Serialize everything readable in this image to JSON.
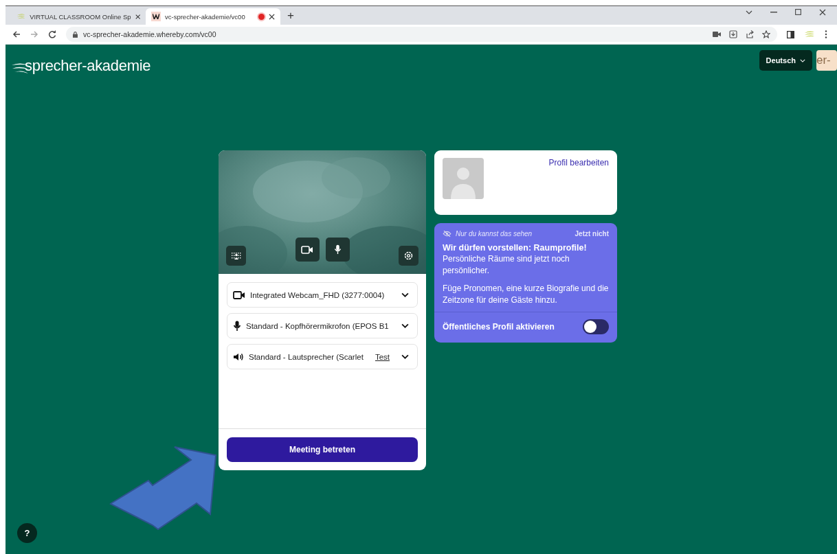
{
  "browser": {
    "tabs": [
      {
        "title": "VIRTUAL CLASSROOM Online Sp",
        "selected": false,
        "recording": false
      },
      {
        "title": "vc-sprecher-akademie/vc00",
        "selected": true,
        "recording": true
      }
    ],
    "new_tab": "+",
    "address": "vc-sprecher-akademie.whereby.com/vc00"
  },
  "header": {
    "logo": "sprecher-akademie",
    "language": "Deutsch",
    "brand_tile": "er-"
  },
  "preview": {
    "camera_on": true,
    "mic_on": true
  },
  "devices": [
    {
      "kind": "camera",
      "label": "Integrated Webcam_FHD (3277:0004)"
    },
    {
      "kind": "microphone",
      "label": "Standard - Kopfhörermikrofon (EPOS B1"
    },
    {
      "kind": "speaker",
      "label": "Standard - Lautsprecher (Scarlet",
      "test": "Test"
    }
  ],
  "join_button": "Meeting betreten",
  "profile": {
    "edit_link": "Profil bearbeiten"
  },
  "promo": {
    "notice": "Nur du kannst das sehen",
    "dismiss": "Jetzt nicht",
    "title": "Wir dürfen vorstellen: Raumprofile!",
    "lines": [
      "Persönliche Räume sind jetzt noch persönlicher.",
      "Füge Pronomen, eine kurze Biografie und die Zeitzone für deine Gäste hinzu."
    ],
    "toggle_label": "Öffentliches Profil aktivieren",
    "toggle_on": false
  },
  "help": "?"
}
